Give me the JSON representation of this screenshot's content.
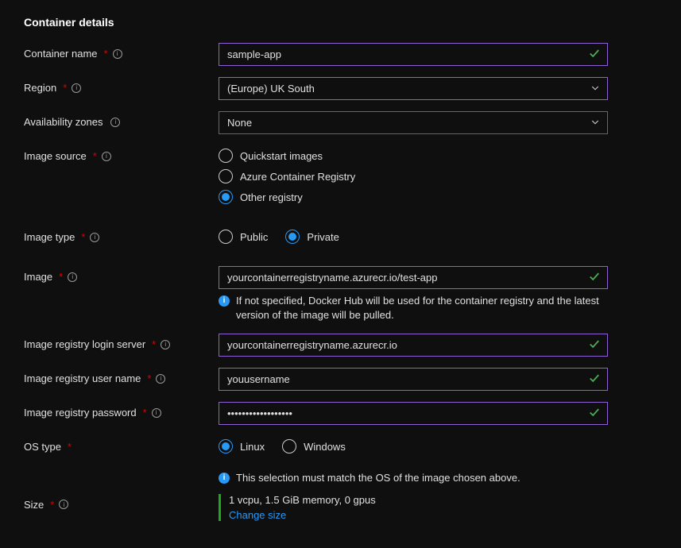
{
  "section_title": "Container details",
  "labels": {
    "container_name": "Container name",
    "region": "Region",
    "availability_zones": "Availability zones",
    "image_source": "Image source",
    "image_type": "Image type",
    "image": "Image",
    "login_server": "Image registry login server",
    "user_name": "Image registry user name",
    "password": "Image registry password",
    "os_type": "OS type",
    "size": "Size"
  },
  "values": {
    "container_name": "sample-app",
    "region": "(Europe) UK South",
    "availability_zones": "None",
    "image": "yourcontainerregistryname.azurecr.io/test-app",
    "login_server": "yourcontainerregistryname.azurecr.io",
    "user_name": "youusername",
    "password": "••••••••••••••••••"
  },
  "radios": {
    "image_source": {
      "quickstart": "Quickstart images",
      "acr": "Azure Container Registry",
      "other": "Other registry",
      "selected": "other"
    },
    "image_type": {
      "public": "Public",
      "private": "Private",
      "selected": "private"
    },
    "os_type": {
      "linux": "Linux",
      "windows": "Windows",
      "selected": "linux"
    }
  },
  "hints": {
    "image": "If not specified, Docker Hub will be used for the container registry and the latest version of the image will be pulled.",
    "os_type": "This selection must match the OS of the image chosen above."
  },
  "size": {
    "summary": "1 vcpu, 1.5 GiB memory, 0 gpus",
    "link": "Change size"
  }
}
